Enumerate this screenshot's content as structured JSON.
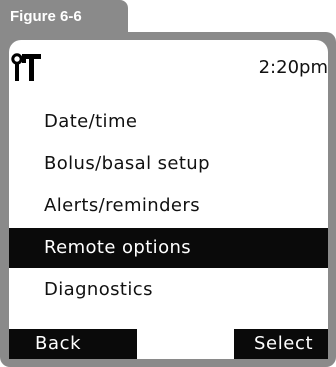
{
  "figure": {
    "label": "Figure 6-6"
  },
  "status_bar": {
    "icon": "settings-tools-icon",
    "time": "2:20pm"
  },
  "menu": {
    "items": [
      {
        "label": "Date/time",
        "selected": false
      },
      {
        "label": "Bolus/basal setup",
        "selected": false
      },
      {
        "label": "Alerts/reminders",
        "selected": false
      },
      {
        "label": "Remote options",
        "selected": true
      },
      {
        "label": "Diagnostics",
        "selected": false
      }
    ]
  },
  "softkeys": {
    "left": "Back",
    "right": "Select"
  },
  "colors": {
    "frame": "#8a8a8a",
    "screen": "#ffffff",
    "highlight": "#0a0a0a",
    "text": "#111111"
  }
}
